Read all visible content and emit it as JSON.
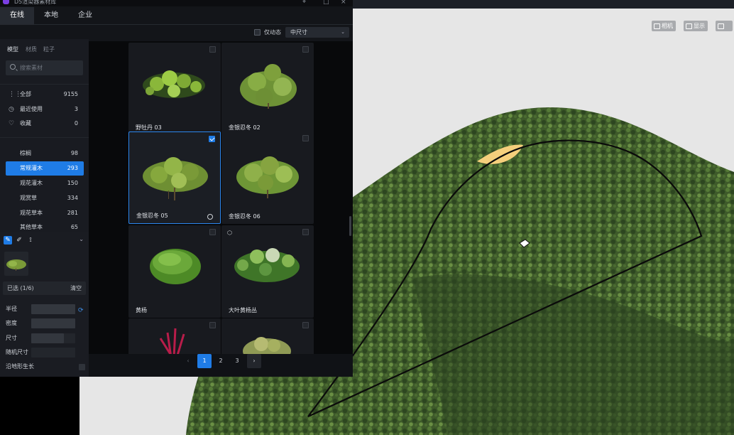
{
  "app": {
    "title": "D5渲染器素材库"
  },
  "main_tabs": [
    {
      "label": "在线"
    },
    {
      "label": "本地"
    },
    {
      "label": "企业"
    }
  ],
  "filter": {
    "dynamic_label": "仅动态",
    "size_value": "中尺寸"
  },
  "sub_tabs": [
    {
      "label": "模型"
    },
    {
      "label": "材质"
    },
    {
      "label": "粒子"
    }
  ],
  "search": {
    "placeholder": "搜索素材"
  },
  "nav": [
    {
      "label": "全部",
      "count": "9155",
      "icon": "grid-icon"
    },
    {
      "label": "最近使用",
      "count": "3",
      "icon": "clock-icon"
    },
    {
      "label": "收藏",
      "count": "0",
      "icon": "heart-icon"
    }
  ],
  "categories": [
    {
      "label": "棕榈",
      "count": "98"
    },
    {
      "label": "常规灌木",
      "count": "293",
      "active": true
    },
    {
      "label": "观花灌木",
      "count": "150"
    },
    {
      "label": "观赏草",
      "count": "334"
    },
    {
      "label": "观花草本",
      "count": "281"
    },
    {
      "label": "其他草本",
      "count": "65"
    }
  ],
  "brush": {
    "selected_label": "已选 (1/6)",
    "clear_label": "清空",
    "params": [
      {
        "label": "半径"
      },
      {
        "label": "密度"
      },
      {
        "label": "尺寸"
      },
      {
        "label": "随机尺寸"
      },
      {
        "label": "沿地形生长"
      }
    ]
  },
  "assets": [
    {
      "name": "野牡丹 03",
      "selected": false,
      "color": "#8ab73a"
    },
    {
      "name": "金银忍冬 02",
      "selected": false,
      "color": "#7ea03c"
    },
    {
      "name": "金银忍冬 05",
      "selected": true,
      "color": "#7a9a38"
    },
    {
      "name": "金银忍冬 06",
      "selected": false,
      "color": "#86a440"
    },
    {
      "name": "黄杨",
      "selected": false,
      "color": "#5d9a2f"
    },
    {
      "name": "大叶黄杨丛",
      "selected": false,
      "color": "#74a84a"
    },
    {
      "name": "",
      "selected": false,
      "color": "#b81d4a"
    },
    {
      "name": "",
      "selected": false,
      "color": "#a6b060"
    }
  ],
  "pagination": {
    "pages": [
      "1",
      "2",
      "3"
    ],
    "current": "1",
    "prev": "‹",
    "next": "›"
  },
  "viewport": {
    "camera_label": "相机",
    "display_label": "显示"
  },
  "colors": {
    "accent": "#1f7ce6",
    "panel_bg": "#131519",
    "foliage": "#3f5a2b",
    "highlight": "#f5cf7c"
  }
}
